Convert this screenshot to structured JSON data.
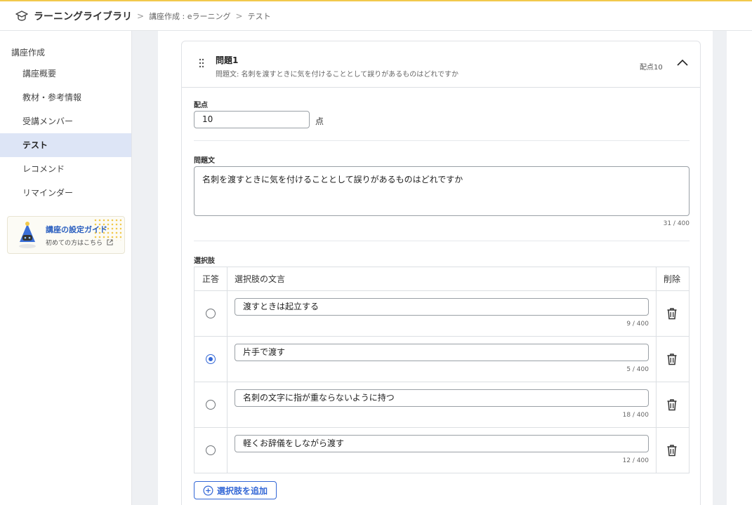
{
  "header": {
    "brand": "ラーニングライブラリ",
    "breadcrumbs": [
      "講座作成 : eラーニング",
      "テスト"
    ]
  },
  "sidebar": {
    "section": "講座作成",
    "items": [
      {
        "label": "講座概要",
        "active": false
      },
      {
        "label": "教材・参考情報",
        "active": false
      },
      {
        "label": "受講メンバー",
        "active": false
      },
      {
        "label": "テスト",
        "active": true
      },
      {
        "label": "レコメンド",
        "active": false
      },
      {
        "label": "リマインダー",
        "active": false
      }
    ],
    "guide": {
      "title": "講座の設定ガイド",
      "subtitle": "初めての方はこちら"
    }
  },
  "question": {
    "title": "問題1",
    "summary": "問題文: 名刺を渡すときに気を付けることとして誤りがあるものはどれですか",
    "score_badge": "配点10",
    "score_label": "配点",
    "score_value": "10",
    "score_unit": "点",
    "text_label": "問題文",
    "text_value": "名刺を渡すときに気を付けることとして誤りがあるものはどれですか",
    "text_counter": "31 / 400"
  },
  "choices": {
    "label": "選択肢",
    "headers": {
      "correct": "正答",
      "text": "選択肢の文言",
      "delete": "削除"
    },
    "rows": [
      {
        "text": "渡すときは起立する",
        "counter": "9 / 400",
        "selected": false
      },
      {
        "text": "片手で渡す",
        "counter": "5 / 400",
        "selected": true
      },
      {
        "text": "名刺の文字に指が重ならないように持つ",
        "counter": "18 / 400",
        "selected": false
      },
      {
        "text": "軽くお辞儀をしながら渡す",
        "counter": "12 / 400",
        "selected": false
      }
    ],
    "add_label": "選択肢を追加"
  },
  "colors": {
    "accent": "#3367d6",
    "top_border": "#f2c94c",
    "active_bg": "#dde5f6"
  }
}
